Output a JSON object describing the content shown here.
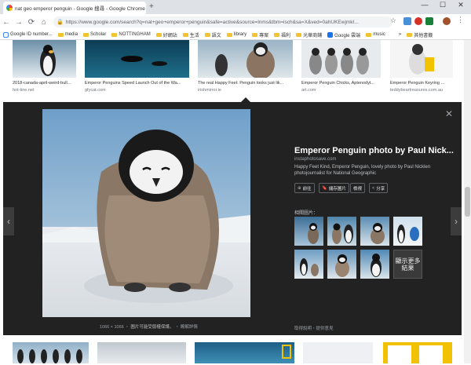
{
  "browser": {
    "tab_title": "nat geo emperor penguin - Google 搜尋 - Google Chrome",
    "new_tab": "+",
    "win_min": "—",
    "win_max": "☐",
    "win_close": "✕",
    "url": "https://www.google.com/search?q=nat+geo+emperor+penguin&safe=active&source=lnms&tbm=isch&sa=X&ved=0ahUKEwjmkI...",
    "nav": {
      "back": "←",
      "forward": "→",
      "reload": "⟳",
      "home": "⌂"
    },
    "star": "☆",
    "lock": "🔒"
  },
  "bookmarks": [
    {
      "label": "Google ID number...",
      "icon": "google-icon"
    },
    {
      "label": "media",
      "icon": "folder-icon"
    },
    {
      "label": "Scholar",
      "icon": "folder-icon"
    },
    {
      "label": "NOTTINGHAM",
      "icon": "folder-icon"
    },
    {
      "label": "好網站",
      "icon": "folder-icon"
    },
    {
      "label": "生活",
      "icon": "folder-icon"
    },
    {
      "label": "語文",
      "icon": "folder-icon"
    },
    {
      "label": "library",
      "icon": "folder-icon"
    },
    {
      "label": "專案",
      "icon": "folder-icon"
    },
    {
      "label": "福利",
      "icon": "folder-icon"
    },
    {
      "label": "光華商鋪",
      "icon": "folder-icon"
    },
    {
      "label": "Google 雲端",
      "icon": "drive-icon"
    },
    {
      "label": "music",
      "icon": "folder-icon"
    }
  ],
  "bookmarks_overflow": "»",
  "bookmarks_other": "其他書籤",
  "top_results": [
    {
      "caption": "2018-canada-april-weird-bull...",
      "source": "hot-tine.net"
    },
    {
      "caption": "Emperor Penguins Speed Launch Out of the Wa...",
      "source": "gfycat.com"
    },
    {
      "caption": "The real Happy Feet: Penguin looks just lik...",
      "source": "irishmirror.ie"
    },
    {
      "caption": "Emperor Penguin Chicks, Aptenodyt...",
      "source": "art.com"
    },
    {
      "caption": "Emperor Penguin Keyring ...",
      "source": "teddybeartreasures.com.au"
    }
  ],
  "viewer": {
    "title": "Emperor Penguin photo by Paul Nick...",
    "domain": "instaphotosave.com",
    "description": "Happy Feet Kind, Emperor Penguin, lovely photo by Paul Nicklen photojournalist for National Geographic",
    "buttons": [
      {
        "label": "前往",
        "icon": "globe-icon",
        "glyph": "⊕"
      },
      {
        "label": "儲存圖片",
        "icon": "bookmark-icon",
        "glyph": "🔖"
      },
      {
        "label": "檢視",
        "icon": "view-icon",
        "glyph": ""
      },
      {
        "label": "分享",
        "icon": "share-icon",
        "glyph": "<"
      }
    ],
    "related_heading": "相關圖片：",
    "more_label": "顯示更多結果",
    "dimensions": "1066 × 1066",
    "copyright_note": "圖片可能受版權保護。",
    "details_link": "瞭解詳情",
    "footer": "取得說明・提供意見",
    "close": "✕",
    "prev": "‹",
    "next": "›"
  }
}
